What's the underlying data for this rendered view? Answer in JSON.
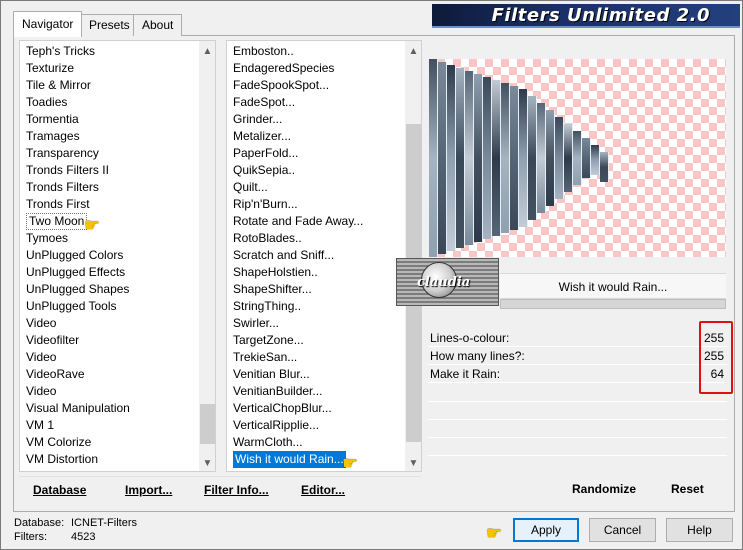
{
  "app": {
    "title": "Filters Unlimited 2.0"
  },
  "tabs": [
    {
      "label": "Navigator",
      "active": true
    },
    {
      "label": "Presets",
      "active": false
    },
    {
      "label": "About",
      "active": false
    }
  ],
  "categories": {
    "items": [
      "Teph's Tricks",
      "Texturize",
      "Tile & Mirror",
      "Toadies",
      "Tormentia",
      "Tramages",
      "Transparency",
      "Tronds Filters II",
      "Tronds Filters",
      "Tronds First",
      "Two Moon",
      "Tymoes",
      "UnPlugged Colors",
      "UnPlugged Effects",
      "UnPlugged Shapes",
      "UnPlugged Tools",
      "Video",
      "Videofilter",
      "Video",
      "VideoRave",
      "Video",
      "Visual Manipulation",
      "VM 1",
      "VM Colorize",
      "VM Distortion"
    ],
    "selected": "Two Moon"
  },
  "filters": {
    "items": [
      "Emboston..",
      "EndageredSpecies",
      "FadeSpookSpot...",
      "FadeSpot...",
      "Grinder...",
      "Metalizer...",
      "PaperFold...",
      "QuikSepia..",
      "Quilt...",
      "Rip'n'Burn...",
      "Rotate and Fade Away...",
      "RotoBlades..",
      "Scratch and Sniff...",
      "ShapeHolstien..",
      "ShapeShifter...",
      "StringThing..",
      "Swirler...",
      "TargetZone...",
      "TrekieSan...",
      "Venitian Blur...",
      "VenitianBuilder...",
      "VerticalChopBlur...",
      "VerticalRipplie...",
      "WarmCloth...",
      "Wish it would Rain..."
    ],
    "selected": "Wish it would Rain..."
  },
  "left_buttons": {
    "database": "Database",
    "import": "Import...",
    "filter_info": "Filter Info...",
    "editor": "Editor..."
  },
  "right_buttons": {
    "randomize": "Randomize",
    "reset": "Reset"
  },
  "preview": {
    "filter_name": "Wish it would Rain...",
    "logo_text": "claudia"
  },
  "params": [
    {
      "label": "Lines-o-colour:",
      "value": "255"
    },
    {
      "label": "How many lines?:",
      "value": "255"
    },
    {
      "label": "Make it Rain:",
      "value": "64"
    }
  ],
  "status": {
    "database_label": "Database:",
    "database_value": "ICNET-Filters",
    "filters_label": "Filters:",
    "filters_value": "4523"
  },
  "dialog_buttons": {
    "apply": "Apply",
    "cancel": "Cancel",
    "help": "Help"
  },
  "colors": {
    "accent": "#0078d7",
    "highlight": "#e01010",
    "checker": "#f9c5c5",
    "banner": "#1a2f66"
  },
  "icons": {
    "pointer": "pointing-hand-icon",
    "scroll_up": "scroll-up-arrow-icon",
    "scroll_down": "scroll-down-arrow-icon"
  }
}
